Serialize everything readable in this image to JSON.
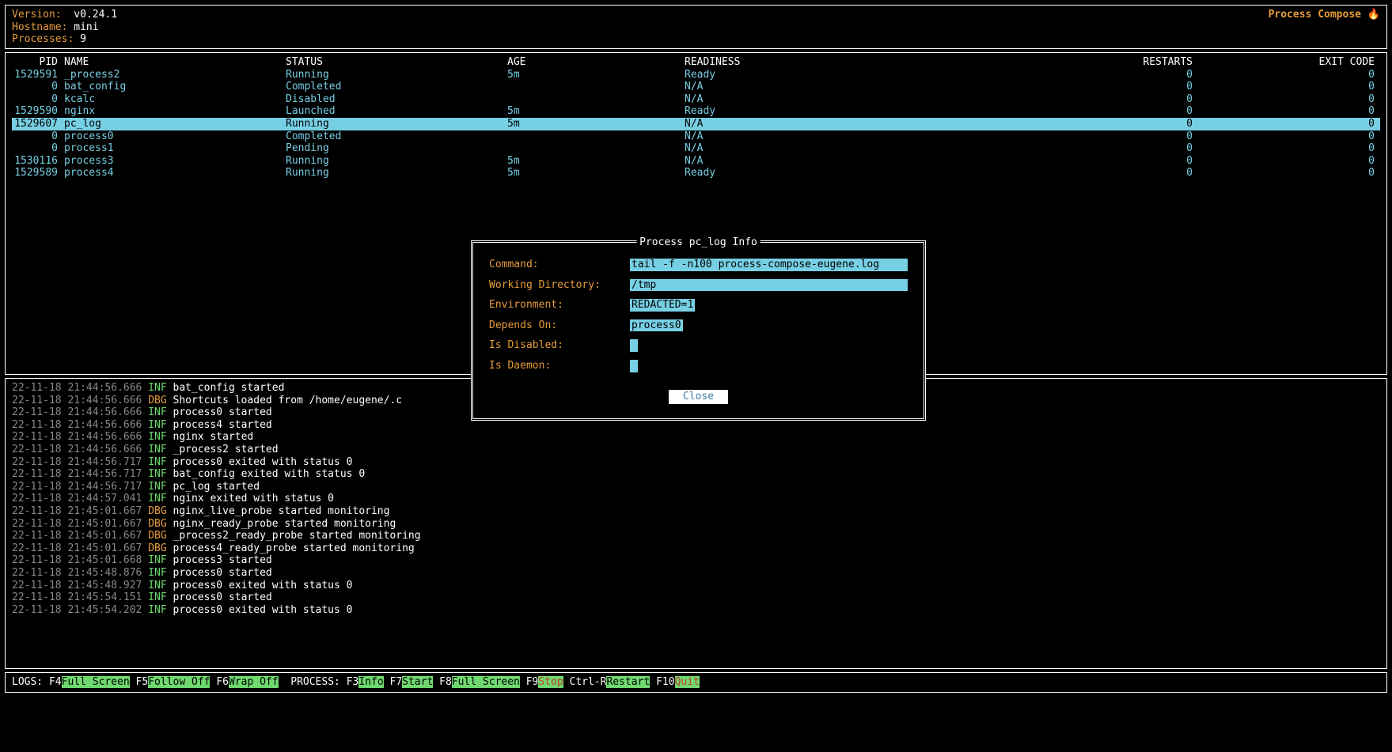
{
  "header": {
    "version_label": "Version:  ",
    "version_value": "v0.24.1",
    "hostname_label": "Hostname: ",
    "hostname_value": "mini",
    "processes_label": "Processes:",
    "processes_value": "9",
    "app_title": "Process Compose ",
    "fire_icon": "🔥"
  },
  "table": {
    "headers": {
      "pid": "PID",
      "name": "NAME",
      "status": "STATUS",
      "age": "AGE",
      "readiness": "READINESS",
      "restarts": "RESTARTS",
      "exit_code": "EXIT CODE"
    },
    "rows": [
      {
        "pid": "1529591",
        "name": "_process2",
        "status": "Running",
        "age": "5m",
        "readiness": "Ready",
        "restarts": "0",
        "exit": "0",
        "sel": false
      },
      {
        "pid": "0",
        "name": "bat_config",
        "status": "Completed",
        "age": "",
        "readiness": "N/A",
        "restarts": "0",
        "exit": "0",
        "sel": false
      },
      {
        "pid": "0",
        "name": "kcalc",
        "status": "Disabled",
        "age": "",
        "readiness": "N/A",
        "restarts": "0",
        "exit": "0",
        "sel": false
      },
      {
        "pid": "1529590",
        "name": "nginx",
        "status": "Launched",
        "age": "5m",
        "readiness": "Ready",
        "restarts": "0",
        "exit": "0",
        "sel": false
      },
      {
        "pid": "1529607",
        "name": "pc_log",
        "status": "Running",
        "age": "5m",
        "readiness": "N/A",
        "restarts": "0",
        "exit": "0",
        "sel": true
      },
      {
        "pid": "0",
        "name": "process0",
        "status": "Completed",
        "age": "",
        "readiness": "N/A",
        "restarts": "0",
        "exit": "0",
        "sel": false
      },
      {
        "pid": "0",
        "name": "process1",
        "status": "Pending",
        "age": "",
        "readiness": "N/A",
        "restarts": "0",
        "exit": "0",
        "sel": false
      },
      {
        "pid": "1530116",
        "name": "process3",
        "status": "Running",
        "age": "5m",
        "readiness": "N/A",
        "restarts": "0",
        "exit": "0",
        "sel": false
      },
      {
        "pid": "1529589",
        "name": "process4",
        "status": "Running",
        "age": "5m",
        "readiness": "Ready",
        "restarts": "0",
        "exit": "0",
        "sel": false
      }
    ]
  },
  "modal": {
    "title": "Process pc_log Info",
    "rows": [
      {
        "label": "Command:",
        "value": "tail -f -n100 process-compose-eugene.log",
        "wide": true
      },
      {
        "label": "Working Directory:",
        "value": "/tmp",
        "wide": true
      },
      {
        "label": "Environment:",
        "value": "REDACTED=1",
        "wide": false
      },
      {
        "label": "Depends On:",
        "value": "process0",
        "wide": false
      },
      {
        "label": "Is Disabled:",
        "value": "",
        "checkbox": true
      },
      {
        "label": "Is Daemon:",
        "value": "",
        "checkbox": true
      }
    ],
    "close_label": "Close"
  },
  "logs": [
    {
      "ts": "22-11-18 21:44:56.666",
      "lv": "INF",
      "msg": "bat_config started"
    },
    {
      "ts": "22-11-18 21:44:56.666",
      "lv": "DBG",
      "msg": "Shortcuts loaded from /home/eugene/.c"
    },
    {
      "ts": "22-11-18 21:44:56.666",
      "lv": "INF",
      "msg": "process0 started"
    },
    {
      "ts": "22-11-18 21:44:56.666",
      "lv": "INF",
      "msg": "process4 started"
    },
    {
      "ts": "22-11-18 21:44:56.666",
      "lv": "INF",
      "msg": "nginx started"
    },
    {
      "ts": "22-11-18 21:44:56.666",
      "lv": "INF",
      "msg": "_process2 started"
    },
    {
      "ts": "22-11-18 21:44:56.717",
      "lv": "INF",
      "msg": "process0 exited with status 0"
    },
    {
      "ts": "22-11-18 21:44:56.717",
      "lv": "INF",
      "msg": "bat_config exited with status 0"
    },
    {
      "ts": "22-11-18 21:44:56.717",
      "lv": "INF",
      "msg": "pc_log started"
    },
    {
      "ts": "22-11-18 21:44:57.041",
      "lv": "INF",
      "msg": "nginx exited with status 0"
    },
    {
      "ts": "22-11-18 21:45:01.667",
      "lv": "DBG",
      "msg": "nginx_live_probe started monitoring"
    },
    {
      "ts": "22-11-18 21:45:01.667",
      "lv": "DBG",
      "msg": "nginx_ready_probe started monitoring"
    },
    {
      "ts": "22-11-18 21:45:01.667",
      "lv": "DBG",
      "msg": "_process2_ready_probe started monitoring"
    },
    {
      "ts": "22-11-18 21:45:01.667",
      "lv": "DBG",
      "msg": "process4_ready_probe started monitoring"
    },
    {
      "ts": "22-11-18 21:45:01.668",
      "lv": "INF",
      "msg": "process3 started"
    },
    {
      "ts": "22-11-18 21:45:48.876",
      "lv": "INF",
      "msg": "process0 started"
    },
    {
      "ts": "22-11-18 21:45:48.927",
      "lv": "INF",
      "msg": "process0 exited with status 0"
    },
    {
      "ts": "22-11-18 21:45:54.151",
      "lv": "INF",
      "msg": "process0 started"
    },
    {
      "ts": "22-11-18 21:45:54.202",
      "lv": "INF",
      "msg": "process0 exited with status 0"
    }
  ],
  "footer": {
    "logs_prefix": "LOGS: ",
    "process_prefix": " PROCESS: ",
    "keys": [
      {
        "k": "F4",
        "a": "Full Screen",
        "style": "hk"
      },
      {
        "k": "F5",
        "a": "Follow Off",
        "style": "hk"
      },
      {
        "k": "F6",
        "a": "Wrap Off",
        "style": "hk"
      }
    ],
    "pkeys": [
      {
        "k": "F3",
        "a": "Info",
        "style": "hk"
      },
      {
        "k": "F7",
        "a": "Start",
        "style": "hk"
      },
      {
        "k": "F8",
        "a": "Full Screen",
        "style": "hk"
      },
      {
        "k": "F9",
        "a": "Stop",
        "style": "r-stop"
      },
      {
        "k": "Ctrl-R",
        "a": "Restart",
        "style": "hk"
      },
      {
        "k": "F10",
        "a": "Quit",
        "style": "r-quit"
      }
    ]
  }
}
